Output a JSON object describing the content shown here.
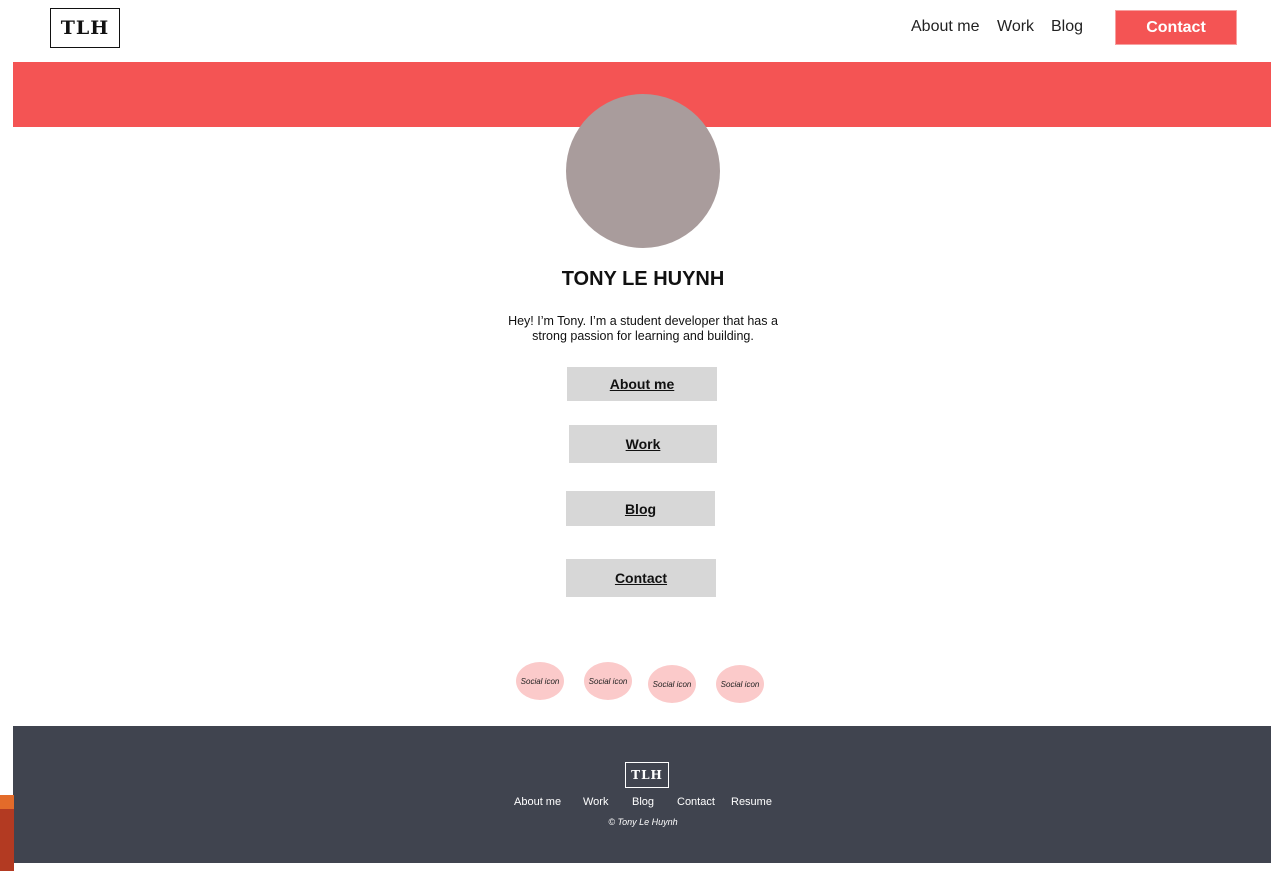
{
  "header": {
    "logo": "TLH",
    "nav": [
      "About me",
      "Work",
      "Blog"
    ],
    "cta": "Contact"
  },
  "colors": {
    "accent": "#f45454",
    "footer": "#40444f",
    "button": "#d7d7d7",
    "avatar": "#a99c9c",
    "social": "#fbcaca"
  },
  "profile": {
    "name": "TONY LE HUYNH",
    "bio": "Hey! I’m Tony. I’m a student developer that has a strong passion for learning and building."
  },
  "menu": [
    "About me",
    "Work",
    "Blog",
    "Contact"
  ],
  "social": [
    "Social icon",
    "Social icon",
    "Social icon",
    "Social icon"
  ],
  "footer": {
    "logo": "TLH",
    "links": [
      "About me",
      "Work",
      "Blog",
      "Contact",
      "Resume"
    ],
    "copyright": "© Tony Le Huynh"
  }
}
